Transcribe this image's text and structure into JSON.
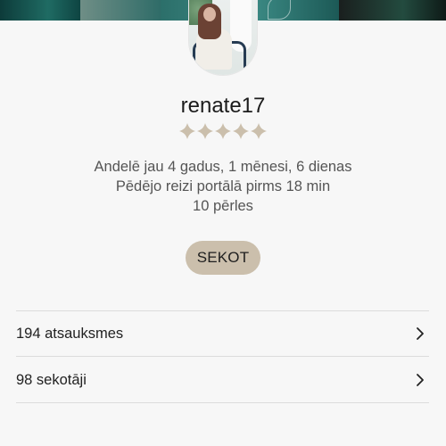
{
  "profile": {
    "username": "renate17",
    "rating_stars": 5,
    "rating_icon": "flower-star-icon",
    "member_since": "Andelē jau 4 gadus, 1 mēnesi, 6 dienas",
    "last_seen": "Pēdējo reizi portālā pirms 18 min",
    "pearls": "10 pērles"
  },
  "actions": {
    "follow_label": "SEKOT"
  },
  "links": [
    {
      "label": "194 atsauksmes",
      "icon": "chevron-right-icon"
    },
    {
      "label": "98 sekotāji",
      "icon": "chevron-right-icon"
    }
  ],
  "colors": {
    "follow_button_bg": "#cbbfac",
    "star_color": "#cbbfac",
    "background": "#f7f7f7"
  }
}
